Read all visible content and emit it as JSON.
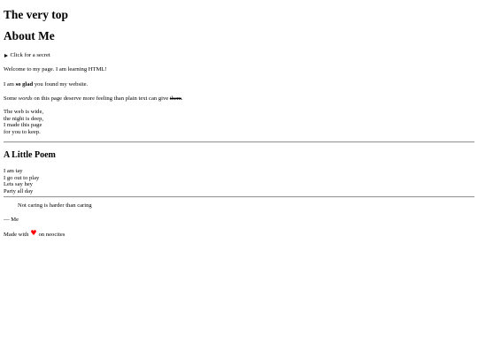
{
  "top": {
    "title": "The very top"
  },
  "about": {
    "title": "About Me",
    "summary": "Click for a secret",
    "welcome": "Welcome to my page. I am learning HTML!",
    "glad_before": "I am ",
    "glad_strong": "so glad",
    "glad_after": " you found my website.",
    "words_before": "Some ",
    "words_em": "words",
    "words_middle": " on this page deserve more feeling than plain text can give ",
    "words_strike": "them",
    "words_after": ".",
    "poem_lines": [
      "The web is wide,",
      "the night is deep,",
      "I made this page",
      "for you to keep."
    ]
  },
  "little_poem": {
    "title": "A Little Poem",
    "lines": [
      "I am tay",
      "I go out to play",
      "Lets say hey",
      "Party all day"
    ]
  },
  "quote": {
    "text": "Not caring is harder than caring",
    "attribution": "— Me"
  },
  "footer": {
    "before": "Made with",
    "heart_icon": "heart-icon",
    "heart_glyph": "♥",
    "heart_color": "#ff0000",
    "after": "on neocites"
  }
}
